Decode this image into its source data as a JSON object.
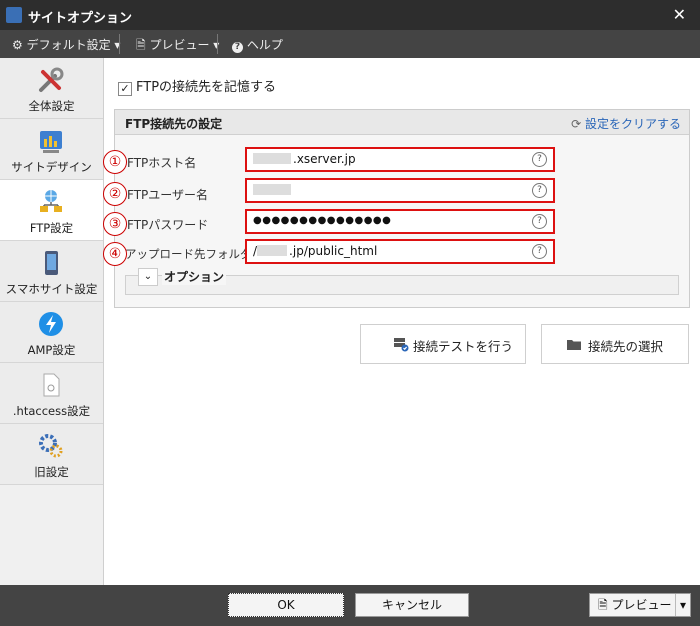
{
  "window": {
    "title": "サイトオプション",
    "close_symbol": "✕"
  },
  "menubar": {
    "default_settings": "デフォルト設定 ▾",
    "preview": "プレビュー ▾",
    "help": "ヘルプ"
  },
  "sidebar": {
    "items": [
      {
        "label": "全体設定",
        "icon": "tools-icon"
      },
      {
        "label": "サイトデザイン",
        "icon": "palette-chart-icon"
      },
      {
        "label": "FTP設定",
        "icon": "network-globe-icon",
        "active": true
      },
      {
        "label": "スマホサイト設定",
        "icon": "smartphone-icon"
      },
      {
        "label": "AMP設定",
        "icon": "lightning-icon"
      },
      {
        "label": ".htaccess設定",
        "icon": "file-icon"
      },
      {
        "label": "旧設定",
        "icon": "gear-icon"
      }
    ]
  },
  "main": {
    "remember_checkbox": {
      "checked_mark": "✓",
      "label": "FTPの接続先を記憶する"
    },
    "group": {
      "title": "FTP接続先の設定",
      "clear_link": "設定をクリアする",
      "fields": [
        {
          "number": "①",
          "label": "FTPホスト名",
          "value": ".xserver.jp",
          "help": "?"
        },
        {
          "number": "②",
          "label": "FTPユーザー名",
          "value": "",
          "help": "?"
        },
        {
          "number": "③",
          "label": "FTPパスワード",
          "value": "●●●●●●●●●●●●●●●",
          "help": "?"
        },
        {
          "number": "④",
          "label": "アップロード先フォルダ",
          "value_prefix": "/",
          "value": ".jp/public_html",
          "help": "?"
        }
      ],
      "options": {
        "chevron": "⌄",
        "label": "オプション"
      }
    },
    "buttons": {
      "test": "接続テストを行う",
      "select": "接続先の選択"
    }
  },
  "footer": {
    "ok": "OK",
    "cancel": "キャンセル",
    "preview": "プレビュー",
    "preview_caret": "▾"
  },
  "colors": {
    "titlebar": "#2d2d2d",
    "menubar": "#444444",
    "highlight_red": "#dd1111",
    "link_blue": "#2a66b8"
  }
}
